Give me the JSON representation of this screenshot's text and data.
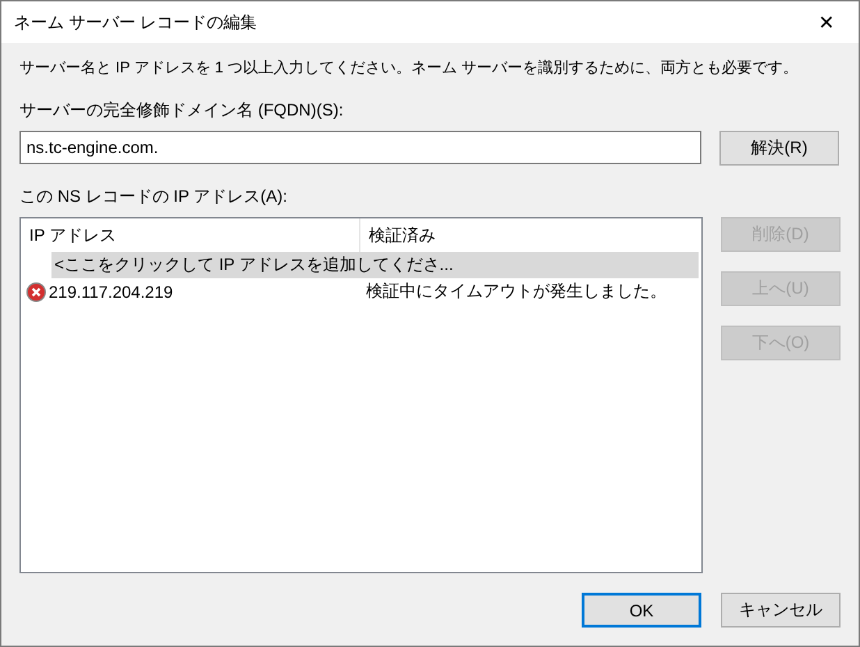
{
  "window": {
    "title": "ネーム サーバー レコードの編集",
    "close": "✕"
  },
  "intro": "サーバー名と IP アドレスを 1 つ以上入力してください。ネーム サーバーを識別するために、両方とも必要です。",
  "fqdn": {
    "label": "サーバーの完全修飾ドメイン名 (FQDN)(S):",
    "value": "ns.tc-engine.com.",
    "button": {
      "label": "解決(R)",
      "disabled": false
    }
  },
  "addresses": {
    "label": "この NS レコードの IP アドレス(A):",
    "columns": [
      "IP アドレス",
      "検証済み"
    ],
    "rows": [
      {
        "kind": "add",
        "cells": [
          "<ここをクリックして IP アドレスを追加してくださ..."
        ],
        "selected": true
      },
      {
        "kind": "entry",
        "error": true,
        "cells": [
          "219.117.204.219",
          "検証中にタイムアウトが発生しました。"
        ],
        "selected": false
      }
    ]
  },
  "side_buttons": [
    {
      "label": "削除(D)",
      "disabled": true
    },
    {
      "label": "上へ(U)",
      "disabled": true
    },
    {
      "label": "下へ(O)",
      "disabled": true
    }
  ],
  "footer_buttons": [
    {
      "label": "OK",
      "default": true
    },
    {
      "label": "キャンセル",
      "default": false
    }
  ]
}
